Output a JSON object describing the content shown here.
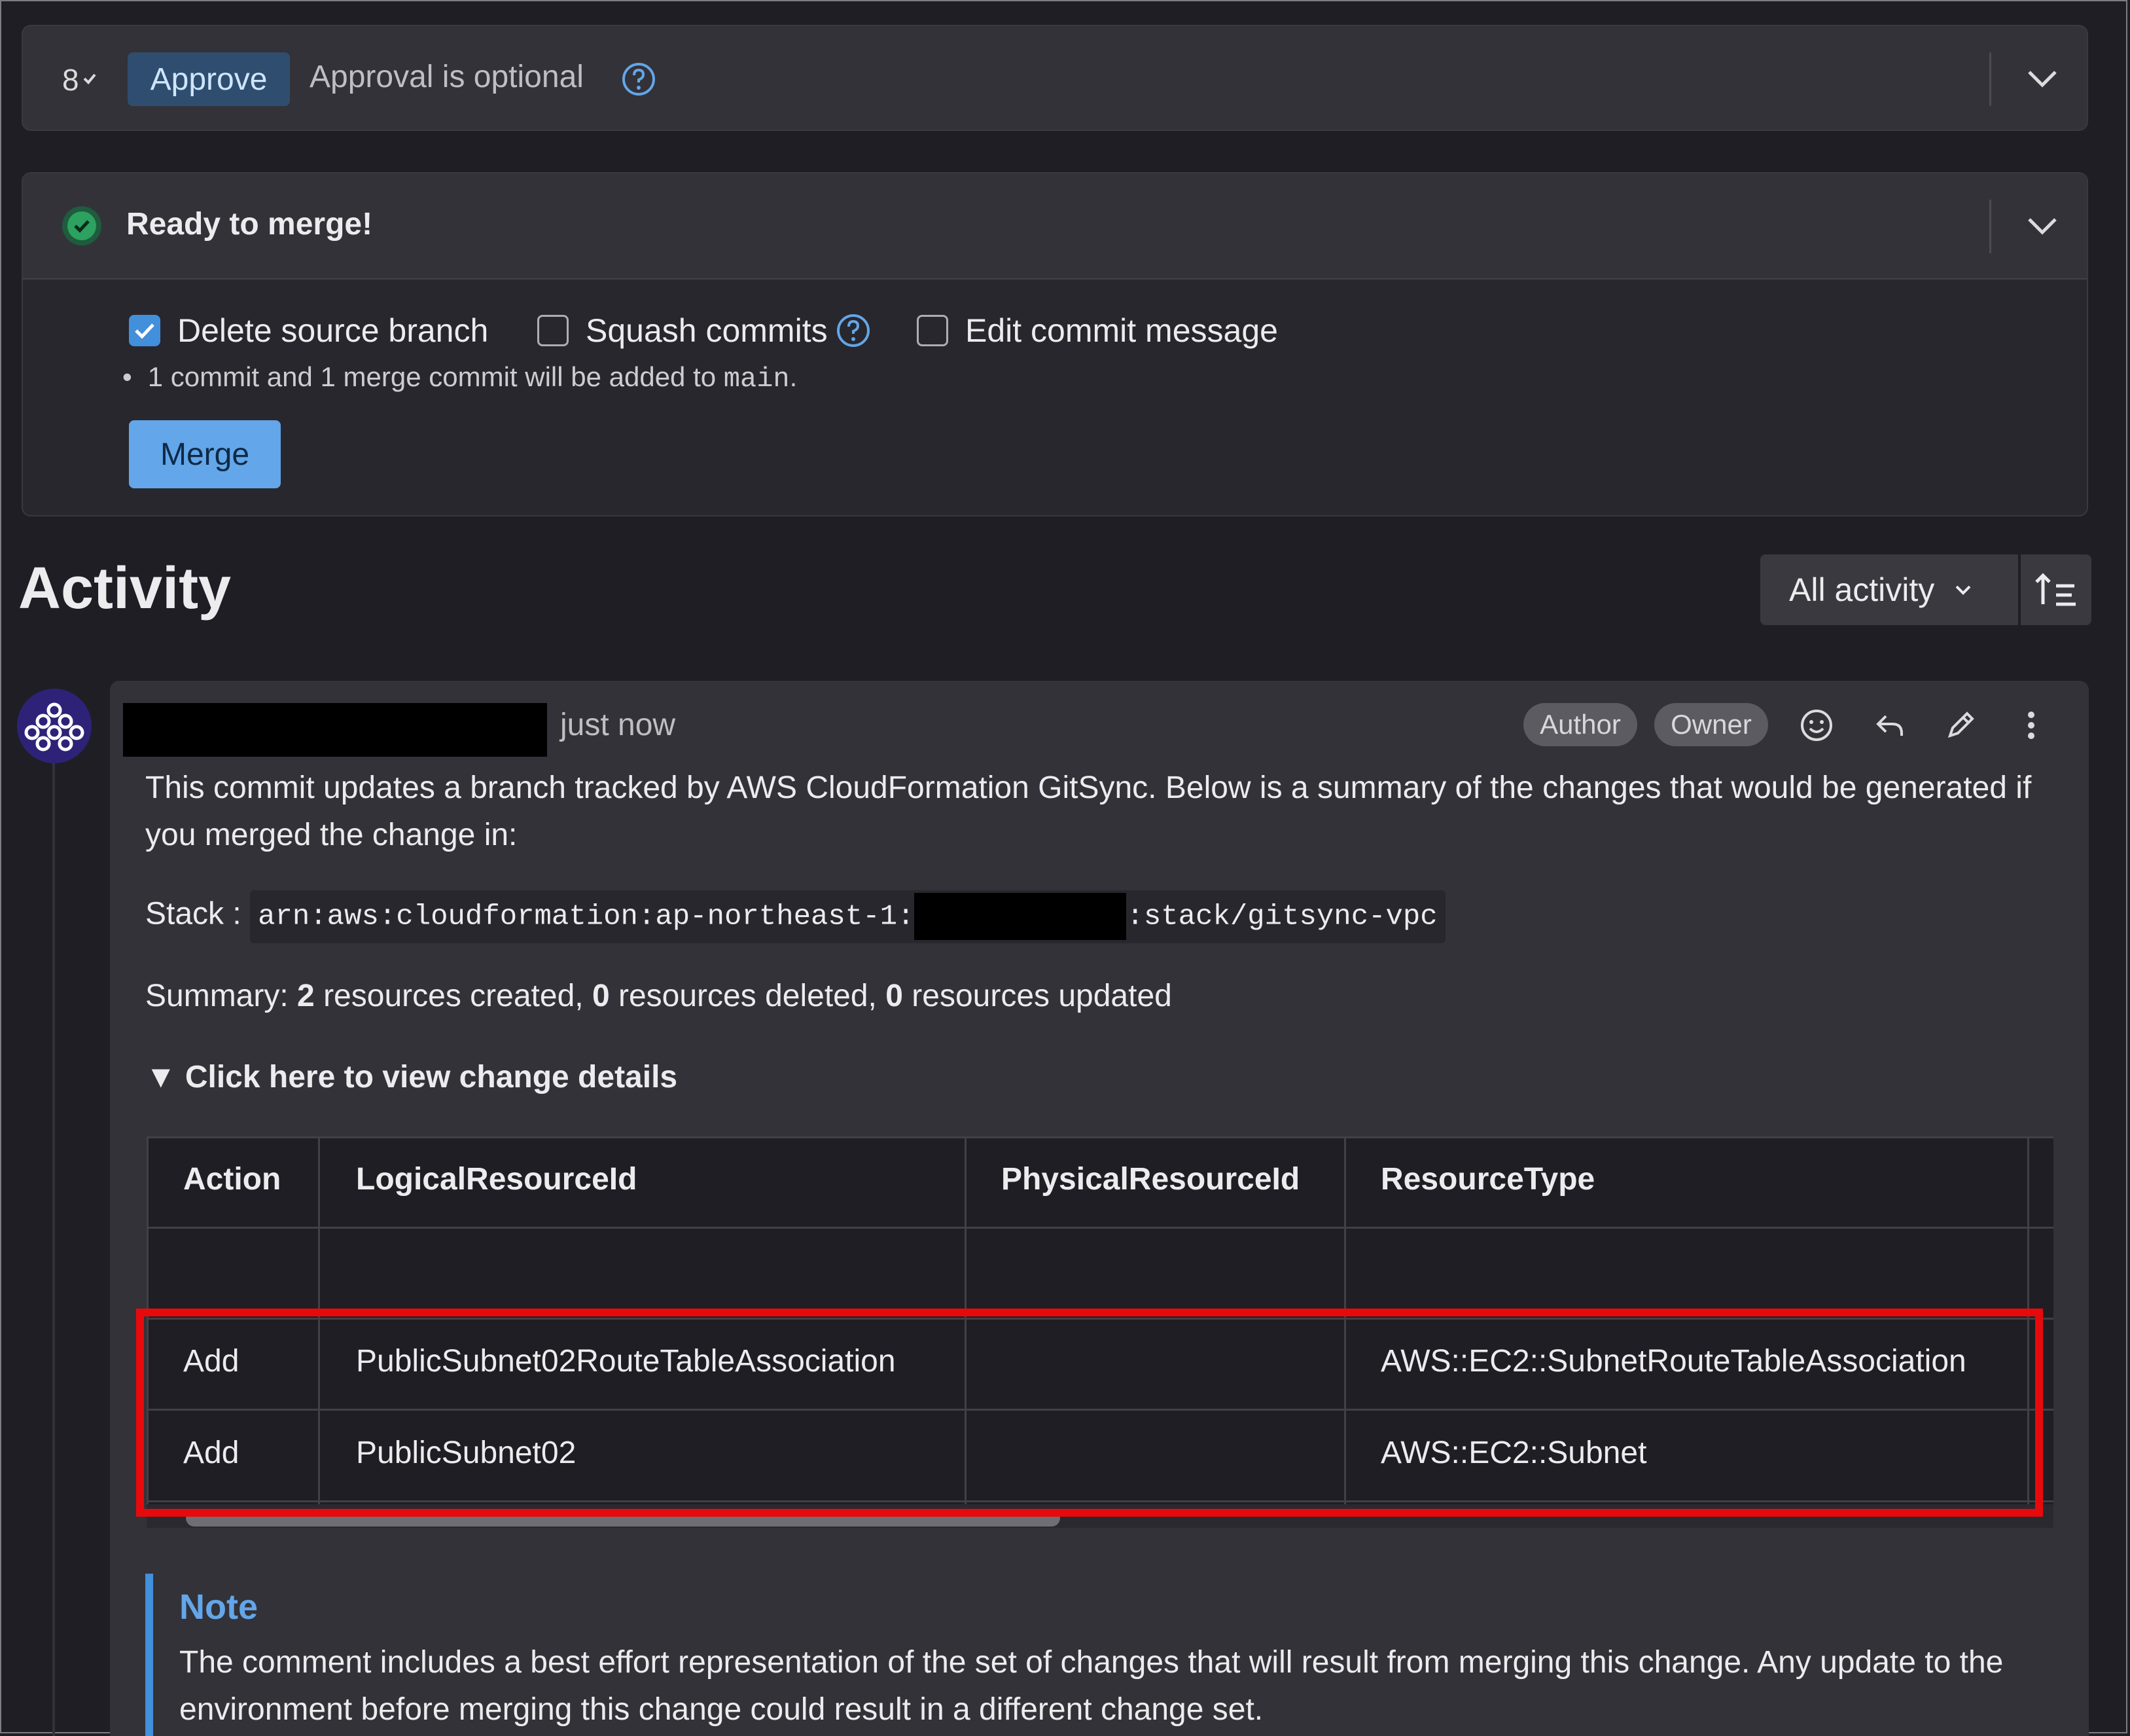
{
  "approval": {
    "approve_label": "Approve",
    "status_text": "Approval is optional",
    "rule_icon": "approval-rules-icon"
  },
  "merge": {
    "status_title": "Ready to merge!",
    "options": [
      {
        "label": "Delete source branch",
        "checked": true
      },
      {
        "label": "Squash commits",
        "checked": false
      },
      {
        "label": "Edit commit message",
        "checked": false
      }
    ],
    "commit_note_prefix": "1 commit and 1 merge commit will be added to ",
    "target_branch": "main",
    "commit_note_suffix": ".",
    "merge_label": "Merge",
    "status_color": "#2da160"
  },
  "activity": {
    "title": "Activity",
    "filter_label": "All activity"
  },
  "comment": {
    "timestamp": "just now",
    "badges": [
      "Author",
      "Owner"
    ],
    "intro": "This commit updates a branch tracked by AWS CloudFormation GitSync. Below is a summary of the changes that would be generated if you merged the change in:",
    "stack_label": "Stack :",
    "stack_arn_prefix": "arn:aws:cloudformation:ap-northeast-1:",
    "stack_arn_suffix": ":stack/gitsync-vpc",
    "summary_prefix": "Summary: ",
    "created_count": "2",
    "created_text": " resources created, ",
    "deleted_count": "0",
    "deleted_text": " resources deleted, ",
    "updated_count": "0",
    "updated_text": " resources updated",
    "details_toggle": "▼ Click here to view change details",
    "table": {
      "headers": [
        "Action",
        "LogicalResourceId",
        "PhysicalResourceId",
        "ResourceType"
      ],
      "rows": [
        [
          "Add",
          "PublicSubnet02RouteTableAssociation",
          "",
          "AWS::EC2::SubnetRouteTableAssociation"
        ],
        [
          "Add",
          "PublicSubnet02",
          "",
          "AWS::EC2::Subnet"
        ]
      ]
    },
    "note_title": "Note",
    "note_body": "The comment includes a best effort representation of the set of changes that will result from merging this change. Any update to the environment before merging this change could result in a different change set."
  },
  "colors": {
    "accent": "#428fdc",
    "highlight": "#e8090c",
    "background": "#1f1e24"
  }
}
